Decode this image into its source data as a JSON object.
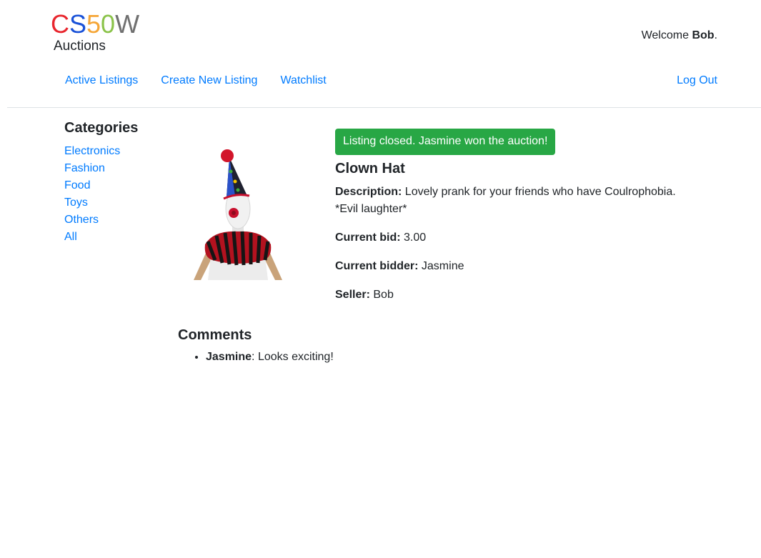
{
  "header": {
    "logo": {
      "letters": [
        {
          "char": "C",
          "color": "#e8262e"
        },
        {
          "char": "S",
          "color": "#1a52d8"
        },
        {
          "char": "5",
          "color": "#f5a637"
        },
        {
          "char": "0",
          "color": "#8bc34a"
        },
        {
          "char": "W",
          "color": "#707070"
        }
      ],
      "subtitle": "Auctions"
    },
    "welcome_prefix": "Welcome ",
    "username": "Bob",
    "welcome_suffix": "."
  },
  "nav": {
    "active_listings": "Active Listings",
    "create_listing": "Create New Listing",
    "watchlist": "Watchlist",
    "logout": "Log Out"
  },
  "sidebar": {
    "heading": "Categories",
    "items": [
      "Electronics",
      "Fashion",
      "Food",
      "Toys",
      "Others",
      "All"
    ]
  },
  "listing": {
    "alert": "Listing closed. Jasmine won the auction!",
    "title": "Clown Hat",
    "description_label": "Description:",
    "description": "Lovely prank for your friends who have Coulrophobia.",
    "description_line2": "*Evil laughter*",
    "current_bid_label": "Current bid:",
    "current_bid": "3.00",
    "current_bidder_label": "Current bidder:",
    "current_bidder": "Jasmine",
    "seller_label": "Seller:",
    "seller": "Bob"
  },
  "comments": {
    "heading": "Comments",
    "items": [
      {
        "author": "Jasmine",
        "text": ": Looks exciting!"
      }
    ]
  },
  "colors": {
    "link": "#007bff",
    "success": "#28a745"
  }
}
